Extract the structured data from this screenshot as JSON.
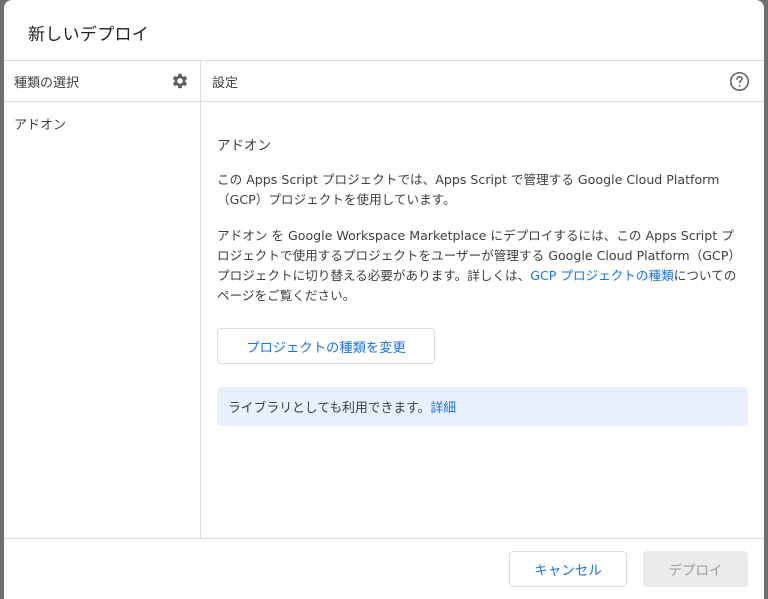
{
  "dialog": {
    "title": "新しいデプロイ"
  },
  "left_panel": {
    "title": "種類の選択",
    "settings_icon": "gear-icon",
    "items": [
      {
        "label": "アドオン"
      }
    ]
  },
  "right_panel": {
    "title": "設定",
    "help_icon": "help-circle-icon",
    "section_heading": "アドオン",
    "paragraph1": "この Apps Script プロジェクトでは、Apps Script で管理する Google Cloud Platform（GCP）プロジェクトを使用しています。",
    "paragraph2_before": "アドオン を Google Workspace Marketplace にデプロイするには、この Apps Script プロジェクトで使用するプロジェクトをユーザーが管理する Google Cloud Platform（GCP）プロジェクトに切り替える必要があります。詳しくは、",
    "paragraph2_link": "GCP プロジェクトの種類",
    "paragraph2_after": "についてのページをご覧ください。",
    "change_button": "プロジェクトの種類を変更",
    "info_text": "ライブラリとしても利用できます。",
    "info_link": "詳細"
  },
  "footer": {
    "cancel_label": "キャンセル",
    "deploy_label": "デプロイ"
  },
  "colors": {
    "accent": "#1a73e8",
    "info_background": "#e8f0fe",
    "divider": "#dadce0",
    "disabled_button": "#ebebeb"
  }
}
